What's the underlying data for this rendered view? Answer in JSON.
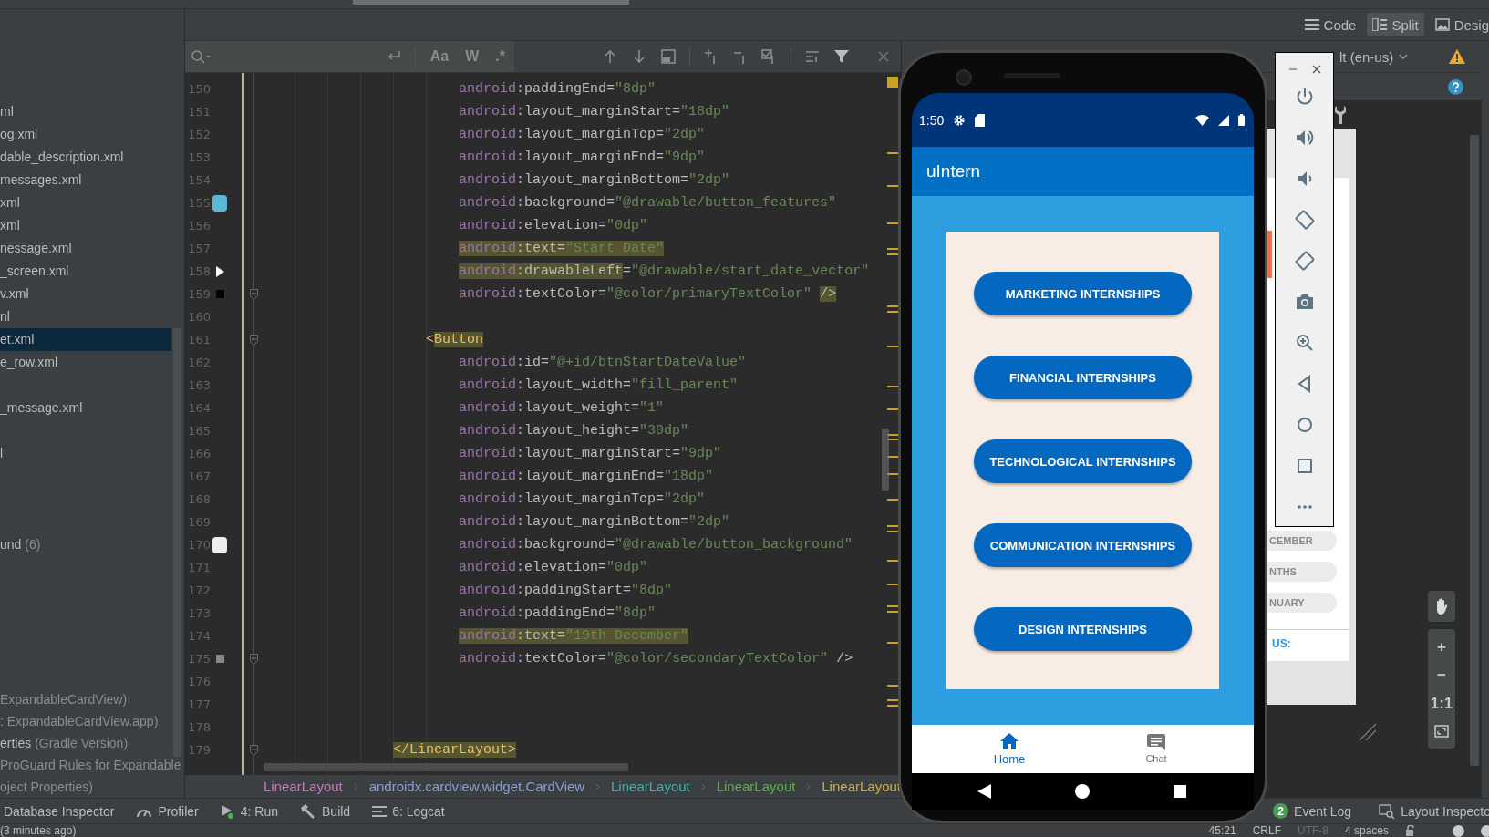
{
  "top_toolbar": {
    "view_modes": [
      {
        "label": "Code",
        "selected": false
      },
      {
        "label": "Split",
        "selected": true
      },
      {
        "label": "Desig",
        "selected": false
      }
    ]
  },
  "project_tree": {
    "items": [
      {
        "label": "ml",
        "selected": false
      },
      {
        "label": "og.xml",
        "selected": false
      },
      {
        "label": "dable_description.xml",
        "selected": false
      },
      {
        "label": "messages.xml",
        "selected": false
      },
      {
        "label": "xml",
        "selected": false
      },
      {
        "label": "xml",
        "selected": false
      },
      {
        "label": "nessage.xml",
        "selected": false
      },
      {
        "label": "_screen.xml",
        "selected": false
      },
      {
        "label": "v.xml",
        "selected": false
      },
      {
        "label": "nl",
        "selected": false
      },
      {
        "label": "et.xml",
        "selected": true
      },
      {
        "label": "e_row.xml",
        "selected": false
      },
      {
        "label": "_message.xml",
        "selected": false
      },
      {
        "label": "l",
        "selected": false
      },
      {
        "label": "und",
        "detail": "(6)",
        "selected": false
      }
    ],
    "footer_items": [
      {
        "detail": "ExpandableCardView)",
        "selected": false
      },
      {
        "detail": ": ExpandableCardView.app)",
        "selected": false
      },
      {
        "label": "erties",
        "detail": "(Gradle Version)",
        "selected": false
      },
      {
        "detail": "ProGuard Rules for Expandable",
        "selected": false
      },
      {
        "detail": "oject Properties)",
        "selected": false
      }
    ]
  },
  "editor": {
    "search": {
      "options": [
        {
          "label": "Aa",
          "selected": false
        },
        {
          "label": "W",
          "selected": false
        },
        {
          "label": ".*",
          "selected": false
        }
      ]
    },
    "lines": [
      {
        "number": "150",
        "fold": false,
        "tokens": [
          {
            "kind": "ns",
            "text": "android",
            "highlighted": false
          },
          {
            "kind": "attr",
            "text": ":paddingEnd=",
            "highlighted": false
          },
          {
            "kind": "str",
            "text": "\"8dp\"",
            "highlighted": false
          }
        ]
      },
      {
        "number": "151",
        "fold": false,
        "tokens": [
          {
            "kind": "ns",
            "text": "android",
            "highlighted": false
          },
          {
            "kind": "attr",
            "text": ":layout_marginStart=",
            "highlighted": false
          },
          {
            "kind": "str",
            "text": "\"18dp\"",
            "highlighted": false
          }
        ]
      },
      {
        "number": "152",
        "fold": false,
        "tokens": [
          {
            "kind": "ns",
            "text": "android",
            "highlighted": false
          },
          {
            "kind": "attr",
            "text": ":layout_marginTop=",
            "highlighted": false
          },
          {
            "kind": "str",
            "text": "\"2dp\"",
            "highlighted": false
          }
        ]
      },
      {
        "number": "153",
        "fold": false,
        "tokens": [
          {
            "kind": "ns",
            "text": "android",
            "highlighted": false
          },
          {
            "kind": "attr",
            "text": ":layout_marginEnd=",
            "highlighted": false
          },
          {
            "kind": "str",
            "text": "\"9dp\"",
            "highlighted": false
          }
        ]
      },
      {
        "number": "154",
        "fold": false,
        "tokens": [
          {
            "kind": "ns",
            "text": "android",
            "highlighted": false
          },
          {
            "kind": "attr",
            "text": ":layout_marginBottom=",
            "highlighted": false
          },
          {
            "kind": "str",
            "text": "\"2dp\"",
            "highlighted": false
          }
        ]
      },
      {
        "number": "155",
        "fold": false,
        "marker": {
          "kind": "swatch",
          "color": "#5bb8d4"
        },
        "tokens": [
          {
            "kind": "ns",
            "text": "android",
            "highlighted": false
          },
          {
            "kind": "attr",
            "text": ":background=",
            "highlighted": false
          },
          {
            "kind": "str",
            "text": "\"@drawable/button_features\"",
            "highlighted": false
          }
        ]
      },
      {
        "number": "156",
        "fold": false,
        "tokens": [
          {
            "kind": "ns",
            "text": "android",
            "highlighted": false
          },
          {
            "kind": "attr",
            "text": ":elevation=",
            "highlighted": false
          },
          {
            "kind": "str",
            "text": "\"0dp\"",
            "highlighted": false
          }
        ]
      },
      {
        "number": "157",
        "fold": false,
        "tokens": [
          {
            "kind": "ns",
            "text": "android",
            "highlighted": true
          },
          {
            "kind": "attr",
            "text": ":text=",
            "highlighted": true
          },
          {
            "kind": "str",
            "text": "\"Start Date\"",
            "highlighted": true
          }
        ]
      },
      {
        "number": "158",
        "fold": false,
        "marker": {
          "kind": "arrow"
        },
        "tokens": [
          {
            "kind": "ns",
            "text": "android",
            "highlighted": true
          },
          {
            "kind": "attr",
            "text": ":drawableLeft",
            "highlighted": true
          },
          {
            "kind": "attr",
            "text": "=",
            "highlighted": false
          },
          {
            "kind": "str",
            "text": "\"@drawable/start_date_vector\"",
            "highlighted": false
          }
        ]
      },
      {
        "number": "159",
        "fold": true,
        "marker": {
          "kind": "dot-swatch",
          "color": "#000000"
        },
        "tokens": [
          {
            "kind": "ns",
            "text": "android",
            "highlighted": false
          },
          {
            "kind": "attr",
            "text": ":textColor=",
            "highlighted": false
          },
          {
            "kind": "str",
            "text": "\"@color/primaryTextColor\" ",
            "highlighted": false
          },
          {
            "kind": "punct",
            "text": "/>",
            "highlighted": true
          }
        ]
      },
      {
        "number": "160",
        "fold": false
      },
      {
        "number": "161",
        "fold": true,
        "tokens": [
          {
            "kind": "tag-open",
            "text": "<",
            "highlighted": false
          },
          {
            "kind": "tag-open",
            "text": "Button",
            "highlighted": true
          }
        ]
      },
      {
        "number": "162",
        "fold": false,
        "tokens": [
          {
            "kind": "ns",
            "text": "android",
            "highlighted": false
          },
          {
            "kind": "attr",
            "text": ":id=",
            "highlighted": false
          },
          {
            "kind": "str",
            "text": "\"@+id/btnStartDateValue\"",
            "highlighted": false
          }
        ]
      },
      {
        "number": "163",
        "fold": false,
        "tokens": [
          {
            "kind": "ns",
            "text": "android",
            "highlighted": false
          },
          {
            "kind": "attr",
            "text": ":layout_width=",
            "highlighted": false
          },
          {
            "kind": "str",
            "text": "\"fill_parent\"",
            "highlighted": false
          }
        ]
      },
      {
        "number": "164",
        "fold": false,
        "tokens": [
          {
            "kind": "ns",
            "text": "android",
            "highlighted": false
          },
          {
            "kind": "attr",
            "text": ":layout_weight=",
            "highlighted": false
          },
          {
            "kind": "str",
            "text": "\"1\"",
            "highlighted": false
          }
        ]
      },
      {
        "number": "165",
        "fold": false,
        "tokens": [
          {
            "kind": "ns",
            "text": "android",
            "highlighted": false
          },
          {
            "kind": "attr",
            "text": ":layout_height=",
            "highlighted": false
          },
          {
            "kind": "str",
            "text": "\"30dp\"",
            "highlighted": false
          }
        ]
      },
      {
        "number": "166",
        "fold": false,
        "tokens": [
          {
            "kind": "ns",
            "text": "android",
            "highlighted": false
          },
          {
            "kind": "attr",
            "text": ":layout_marginStart=",
            "highlighted": false
          },
          {
            "kind": "str",
            "text": "\"9dp\"",
            "highlighted": false
          }
        ]
      },
      {
        "number": "167",
        "fold": false,
        "tokens": [
          {
            "kind": "ns",
            "text": "android",
            "highlighted": false
          },
          {
            "kind": "attr",
            "text": ":layout_marginEnd=",
            "highlighted": false
          },
          {
            "kind": "str",
            "text": "\"18dp\"",
            "highlighted": false
          }
        ]
      },
      {
        "number": "168",
        "fold": false,
        "tokens": [
          {
            "kind": "ns",
            "text": "android",
            "highlighted": false
          },
          {
            "kind": "attr",
            "text": ":layout_marginTop=",
            "highlighted": false
          },
          {
            "kind": "str",
            "text": "\"2dp\"",
            "highlighted": false
          }
        ]
      },
      {
        "number": "169",
        "fold": false,
        "tokens": [
          {
            "kind": "ns",
            "text": "android",
            "highlighted": false
          },
          {
            "kind": "attr",
            "text": ":layout_marginBottom=",
            "highlighted": false
          },
          {
            "kind": "str",
            "text": "\"2dp\"",
            "highlighted": false
          }
        ]
      },
      {
        "number": "170",
        "fold": false,
        "marker": {
          "kind": "swatch",
          "color": "#eeeeee"
        },
        "tokens": [
          {
            "kind": "ns",
            "text": "android",
            "highlighted": false
          },
          {
            "kind": "attr",
            "text": ":background=",
            "highlighted": false
          },
          {
            "kind": "str",
            "text": "\"@drawable/button_background\"",
            "highlighted": false
          }
        ]
      },
      {
        "number": "171",
        "fold": false,
        "tokens": [
          {
            "kind": "ns",
            "text": "android",
            "highlighted": false
          },
          {
            "kind": "attr",
            "text": ":elevation=",
            "highlighted": false
          },
          {
            "kind": "str",
            "text": "\"0dp\"",
            "highlighted": false
          }
        ]
      },
      {
        "number": "172",
        "fold": false,
        "tokens": [
          {
            "kind": "ns",
            "text": "android",
            "highlighted": false
          },
          {
            "kind": "attr",
            "text": ":paddingStart=",
            "highlighted": false
          },
          {
            "kind": "str",
            "text": "\"8dp\"",
            "highlighted": false
          }
        ]
      },
      {
        "number": "173",
        "fold": false,
        "tokens": [
          {
            "kind": "ns",
            "text": "android",
            "highlighted": false
          },
          {
            "kind": "attr",
            "text": ":paddingEnd=",
            "highlighted": false
          },
          {
            "kind": "str",
            "text": "\"8dp\"",
            "highlighted": false
          }
        ]
      },
      {
        "number": "174",
        "fold": false,
        "tokens": [
          {
            "kind": "ns",
            "text": "android",
            "highlighted": true
          },
          {
            "kind": "attr",
            "text": ":text=",
            "highlighted": true
          },
          {
            "kind": "str",
            "text": "\"19th December\"",
            "highlighted": true
          }
        ]
      },
      {
        "number": "175",
        "fold": true,
        "marker": {
          "kind": "dot-swatch",
          "color": "#888888"
        },
        "tokens": [
          {
            "kind": "ns",
            "text": "android",
            "highlighted": false
          },
          {
            "kind": "attr",
            "text": ":textColor=",
            "highlighted": false
          },
          {
            "kind": "str",
            "text": "\"@color/secondaryTextColor\" ",
            "highlighted": false
          },
          {
            "kind": "punct",
            "text": "/>",
            "highlighted": false
          }
        ]
      },
      {
        "number": "176",
        "fold": false
      },
      {
        "number": "177",
        "fold": false
      },
      {
        "number": "178",
        "fold": false
      },
      {
        "number": "179",
        "fold": true,
        "tokens": [
          {
            "kind": "tag-close",
            "text": "</LinearLayout>",
            "highlighted": true
          }
        ]
      }
    ],
    "breadcrumbs": [
      {
        "label": "LinearLayout",
        "color": "#c678c0"
      },
      {
        "label": "androidx.cardview.widget.CardView",
        "color": "#8b9fd4"
      },
      {
        "label": "LinearLayout",
        "color": "#3fb0b0"
      },
      {
        "label": "LinearLayout",
        "color": "#5fae4d"
      },
      {
        "label": "LinearLayout",
        "color": "#c9b04c"
      }
    ]
  },
  "design_pane": {
    "locale": "lt (en-us)",
    "preview": [
      {
        "kind": "chip",
        "text": "CEMBER"
      },
      {
        "kind": "chip",
        "text": "NTHS"
      },
      {
        "kind": "chip",
        "text": "NUARY"
      },
      {
        "kind": "link",
        "text": "US:"
      }
    ],
    "zoom_controls": [
      "+",
      "−",
      "1:1"
    ]
  },
  "emulator": {
    "time": "1:50",
    "title": "uIntern",
    "buttons": [
      "MARKETING INTERNSHIPS",
      "FINANCIAL INTERNSHIPS",
      "TECHNOLOGICAL INTERNSHIPS",
      "COMMUNICATION INTERNSHIPS",
      "DESIGN INTERNSHIPS"
    ],
    "nav": [
      {
        "label": "Home",
        "selected": true
      },
      {
        "label": "Chat",
        "selected": false
      }
    ]
  },
  "tool_windows": {
    "left": [
      {
        "label": "Database Inspector"
      },
      {
        "label": "Profiler"
      },
      {
        "label": "4: Run"
      },
      {
        "label": "Build"
      },
      {
        "label": "6: Logcat"
      }
    ],
    "right": [
      {
        "label": "Event Log",
        "badge": "2"
      },
      {
        "label": "Layout Inspecto"
      }
    ]
  },
  "status_bar": {
    "message": "(3 minutes ago)",
    "items": [
      {
        "text": "45:21",
        "disabled": false
      },
      {
        "text": "CRLF",
        "disabled": false
      },
      {
        "text": "UTF-8",
        "disabled": true
      },
      {
        "text": "4 spaces",
        "disabled": false
      }
    ]
  }
}
